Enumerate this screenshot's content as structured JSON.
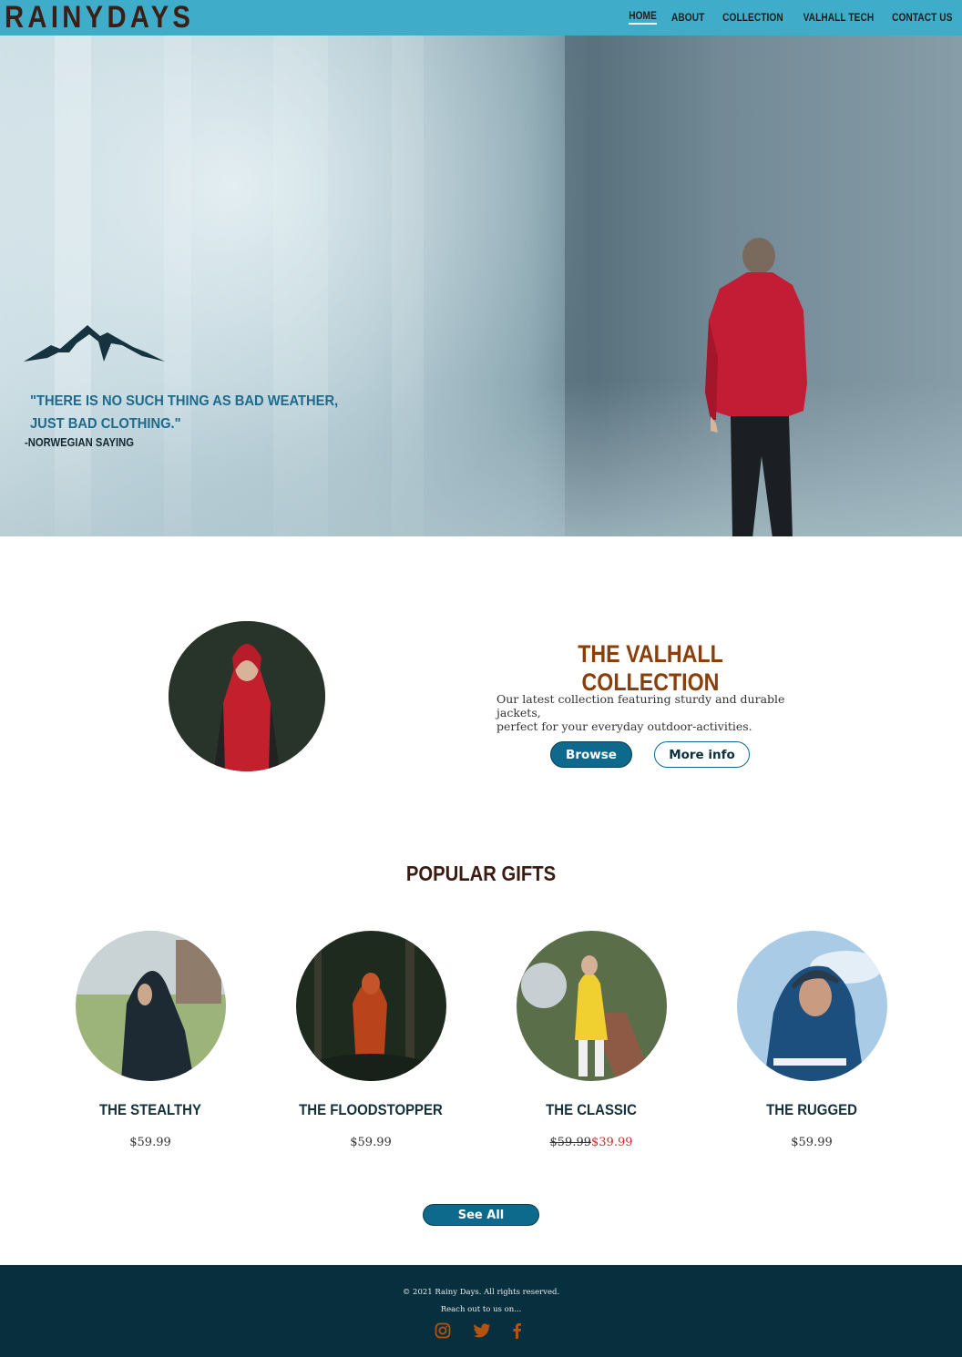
{
  "header": {
    "logo": "RAINYDAYS",
    "nav": [
      "HOME",
      "ABOUT",
      "COLLECTION",
      "VALHALL TECH",
      "CONTACT US"
    ],
    "active": "HOME",
    "bg_color": "#3fadca"
  },
  "hero": {
    "quote_line1": "\"THERE IS NO SUCH THING AS BAD WEATHER,",
    "quote_line2": "JUST BAD CLOTHING.\"",
    "quote_source": "-NORWEGIAN SAYING"
  },
  "collection": {
    "title": "THE VALHALL COLLECTION",
    "description_line1": "Our latest collection featuring sturdy and durable jackets,",
    "description_line2": "perfect for your everyday outdoor-activities.",
    "browse_label": "Browse",
    "more_info_label": "More info"
  },
  "gifts": {
    "title": "POPULAR GIFTS",
    "products": [
      {
        "name": "THE STEALTHY",
        "price": "$59.99"
      },
      {
        "name": "THE FLOODSTOPPER",
        "price": "$59.99"
      },
      {
        "name": "THE CLASSIC",
        "old_price": "$59.99",
        "price": "$39.99"
      },
      {
        "name": "THE RUGGED",
        "price": "$59.99"
      }
    ],
    "see_all_label": "See All"
  },
  "footer": {
    "copyright": "© 2021 Rainy Days. All rights reserved.",
    "reach": "Reach out to us on...",
    "social_icons": [
      "instagram-icon",
      "twitter-icon",
      "facebook-icon"
    ],
    "icon_color": "#b5520f",
    "bg_color": "#072f3d"
  }
}
